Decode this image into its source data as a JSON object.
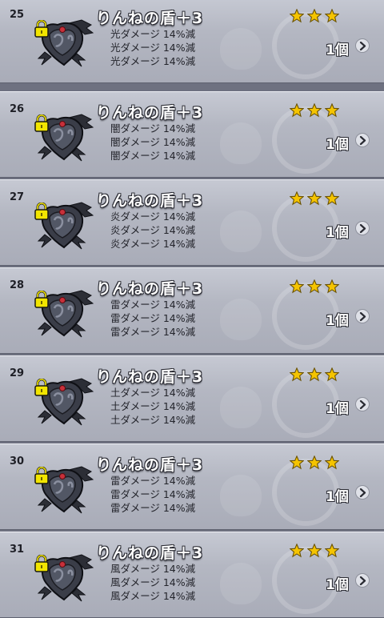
{
  "colors": {
    "star": "#f5c400",
    "lock": "#f2e500",
    "panel": "#b4b7c2"
  },
  "icons": {
    "item": "shield-icon",
    "lock": "lock-icon",
    "star": "star-icon",
    "detail": "chevron-right-icon"
  },
  "items": [
    {
      "no": "25",
      "name": "りんねの盾＋3",
      "rarity_stars": 3,
      "qty": "1個",
      "effects": [
        "光ダメージ 14%減",
        "光ダメージ 14%減",
        "光ダメージ 14%減"
      ]
    },
    {
      "no": "26",
      "name": "りんねの盾＋3",
      "rarity_stars": 3,
      "qty": "1個",
      "effects": [
        "闇ダメージ 14%減",
        "闇ダメージ 14%減",
        "闇ダメージ 14%減"
      ]
    },
    {
      "no": "27",
      "name": "りんねの盾＋3",
      "rarity_stars": 3,
      "qty": "1個",
      "effects": [
        "炎ダメージ 14%減",
        "炎ダメージ 14%減",
        "炎ダメージ 14%減"
      ]
    },
    {
      "no": "28",
      "name": "りんねの盾＋3",
      "rarity_stars": 3,
      "qty": "1個",
      "effects": [
        "雷ダメージ 14%減",
        "雷ダメージ 14%減",
        "雷ダメージ 14%減"
      ]
    },
    {
      "no": "29",
      "name": "りんねの盾＋3",
      "rarity_stars": 3,
      "qty": "1個",
      "effects": [
        "土ダメージ 14%減",
        "土ダメージ 14%減",
        "土ダメージ 14%減"
      ]
    },
    {
      "no": "30",
      "name": "りんねの盾＋3",
      "rarity_stars": 3,
      "qty": "1個",
      "effects": [
        "雷ダメージ 14%減",
        "雷ダメージ 14%減",
        "雷ダメージ 14%減"
      ]
    },
    {
      "no": "31",
      "name": "りんねの盾＋3",
      "rarity_stars": 3,
      "qty": "1個",
      "effects": [
        "風ダメージ 14%減",
        "風ダメージ 14%減",
        "風ダメージ 14%減"
      ]
    }
  ]
}
